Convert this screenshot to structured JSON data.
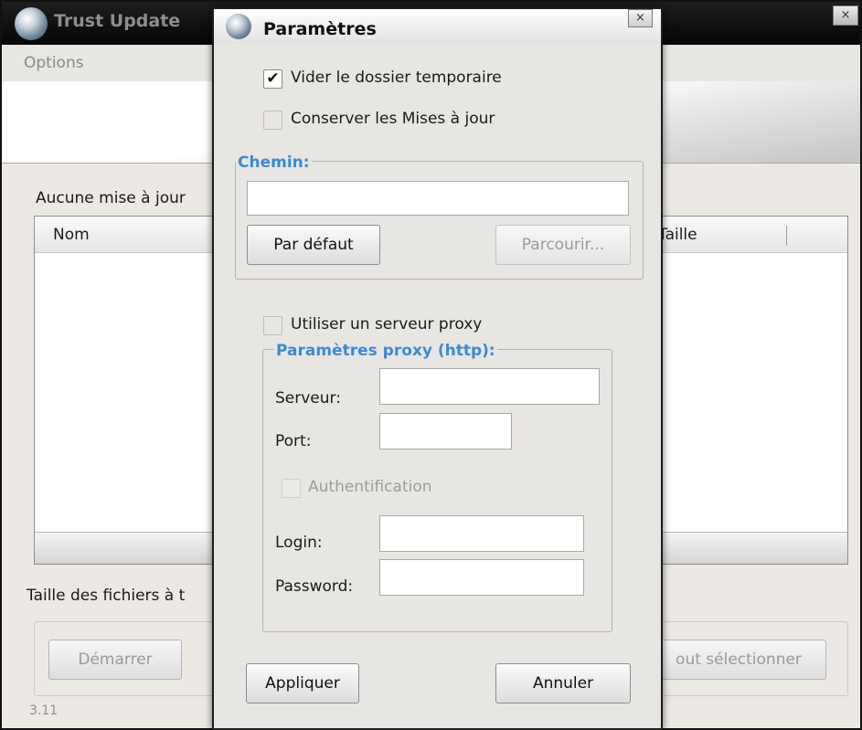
{
  "background_window": {
    "title": "Trust Update",
    "close_glyph": "×",
    "menu": {
      "options": "Options"
    },
    "status_text": "Aucune mise à jour",
    "list": {
      "col_name": "Nom",
      "col_size": "Taille"
    },
    "size_label": "Taille des fichiers à t",
    "buttons": {
      "start": "Démarrer",
      "select_all": "out sélectionner"
    },
    "version": "3.11"
  },
  "dialog": {
    "title": "Paramètres",
    "close_glyph": "×",
    "checkboxes": {
      "clear_temp": {
        "label": "Vider le dossier temporaire",
        "checked": true,
        "mark": "✔"
      },
      "keep_updates": {
        "label": "Conserver les Mises à jour",
        "checked": false
      },
      "use_proxy": {
        "label": "Utiliser un serveur proxy",
        "checked": false
      },
      "authentication": {
        "label": "Authentification",
        "checked": false
      }
    },
    "path_group": {
      "title": "Chemin:",
      "value": "",
      "default_button": "Par défaut",
      "browse_button": "Parcourir..."
    },
    "proxy_group": {
      "title": "Paramètres proxy (http):",
      "server_label": "Serveur:",
      "server_value": "",
      "port_label": "Port:",
      "port_value": "",
      "login_label": "Login:",
      "login_value": "",
      "password_label": "Password:",
      "password_value": ""
    },
    "buttons": {
      "apply": "Appliquer",
      "cancel": "Annuler"
    }
  },
  "colors": {
    "group_title": "#3b8ad3",
    "titlebar_dark": "#050505",
    "dialog_bg": "#e8e6e2"
  },
  "icons": {
    "app_icon": "globe-icon"
  }
}
